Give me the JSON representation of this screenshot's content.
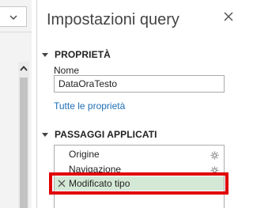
{
  "pane": {
    "title": "Impostazioni query",
    "close_icon": "close-icon"
  },
  "properties": {
    "section_title": "PROPRIETÀ",
    "name_label": "Nome",
    "name_value": "DataOraTesto",
    "all_properties_link": "Tutte le proprietà"
  },
  "applied_steps": {
    "section_title": "PASSAGGI APPLICATI",
    "steps": [
      {
        "label": "Origine",
        "icon": "gear-icon"
      },
      {
        "label": "Navigazione",
        "icon": "gear-icon"
      },
      {
        "label": "Modificato tipo",
        "icon": "delete-step-icon",
        "selected": true
      }
    ]
  },
  "left_area": {
    "dropdown_icon": "chevron-down-icon",
    "scroll_up_icon": "chevron-up-icon"
  },
  "colors": {
    "highlight": "#e00000",
    "selected_step": "#d4e8d6",
    "link": "#1f6fb5"
  }
}
